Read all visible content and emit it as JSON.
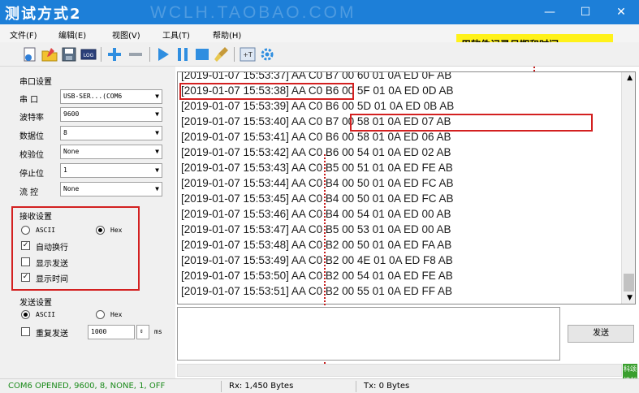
{
  "window": {
    "title": "测试方式2",
    "watermark": "WCLH.TAOBAO.COM",
    "minimize_label": "—",
    "maximize_label": "☐",
    "close_label": "✕"
  },
  "menu": [
    "文件(F)",
    "编辑(E)",
    "视图(V)",
    "工具(T)",
    "帮助(H)"
  ],
  "toolbar": {
    "icons": [
      "new-icon",
      "open-icon",
      "save-icon",
      "log-icon",
      "plus-icon",
      "minus-icon",
      "play-icon",
      "pause-icon",
      "stop-icon",
      "clear-icon",
      "hex-icon",
      "settings-icon"
    ]
  },
  "serial": {
    "group_title": "串口设置",
    "port_label": "串  口",
    "port_value": "USB-SER...(COM6",
    "baud_label": "波特率",
    "baud_value": "9600",
    "databits_label": "数据位",
    "databits_value": "8",
    "parity_label": "校验位",
    "parity_value": "None",
    "stopbits_label": "停止位",
    "stopbits_value": "1",
    "flow_label": "流  控",
    "flow_value": "None"
  },
  "receive": {
    "group_title": "接收设置",
    "ascii_label": "ASCII",
    "hex_label": "Hex",
    "auto_wrap_label": "自动换行",
    "show_send_label": "显示发送",
    "show_time_label": "显示时间",
    "check_mark": "✓"
  },
  "send_settings": {
    "group_title": "发送设置",
    "ascii_label": "ASCII",
    "hex_label": "Hex",
    "repeat_label": "重复发送",
    "interval_value": "1000",
    "interval_unit": "ms",
    "spin_symbol": "⇕"
  },
  "log_lines": [
    "[2019-01-07 15:53:37] AA C0 B7 00 60 01 0A ED 0F AB",
    "[2019-01-07 15:53:38] AA C0 B6 00 5F 01 0A ED 0D AB",
    "[2019-01-07 15:53:39] AA C0 B6 00 5D 01 0A ED 0B AB",
    "[2019-01-07 15:53:40] AA C0 B7 00 58 01 0A ED 07 AB",
    "[2019-01-07 15:53:41] AA C0 B6 00 58 01 0A ED 06 AB",
    "[2019-01-07 15:53:42] AA C0 B6 00 54 01 0A ED 02 AB",
    "[2019-01-07 15:53:43] AA C0 B5 00 51 01 0A ED FE AB",
    "[2019-01-07 15:53:44] AA C0 B4 00 50 01 0A ED FC AB",
    "[2019-01-07 15:53:45] AA C0 B4 00 50 01 0A ED FC AB",
    "[2019-01-07 15:53:46] AA C0 B4 00 54 01 0A ED 00 AB",
    "[2019-01-07 15:53:47] AA C0 B5 00 53 01 0A ED 00 AB",
    "[2019-01-07 15:53:48] AA C0 B2 00 50 01 0A ED FA AB",
    "[2019-01-07 15:53:49] AA C0 B2 00 4E 01 0A ED F8 AB",
    "[2019-01-07 15:53:50] AA C0 B2 00 54 01 0A ED FE AB",
    "[2019-01-07 15:53:51] AA C0 B2 00 55 01 0A ED FF AB"
  ],
  "scroll": {
    "up": "▲",
    "down": "▼"
  },
  "callout": "用软件记录日期和时间",
  "send_button": "发送",
  "badge": {
    "line1": "科颂",
    "line2": "技创"
  },
  "status": {
    "com": "COM6 OPENED, 9600, 8, NONE, 1, OFF",
    "rx": "Rx: 1,450 Bytes",
    "tx": "Tx: 0 Bytes"
  },
  "colors": {
    "titlebar": "#1d7fd8",
    "highlight_red": "#d32020",
    "callout_yellow": "#fff21a",
    "status_green": "#1a8a1a"
  }
}
